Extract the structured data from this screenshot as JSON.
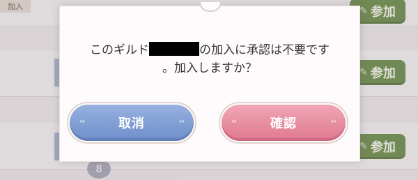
{
  "background": {
    "left_tag": "加入",
    "rows": [
      {
        "join_label": "参加"
      },
      {
        "join_label": "参加"
      },
      {
        "join_label": "参加"
      }
    ],
    "badge": "8"
  },
  "dialog": {
    "message_before": "このギルド",
    "message_after": "の加入に承認は不要です",
    "message_line2": "。加入しますか？",
    "cancel_label": "取消",
    "confirm_label": "確認"
  },
  "colors": {
    "cancel": "#7f9ed6",
    "confirm": "#e98ba1",
    "join": "#6f8f4e"
  },
  "icons": {
    "join": "pen-icon",
    "button_arrows": "double-chevron-icon"
  }
}
